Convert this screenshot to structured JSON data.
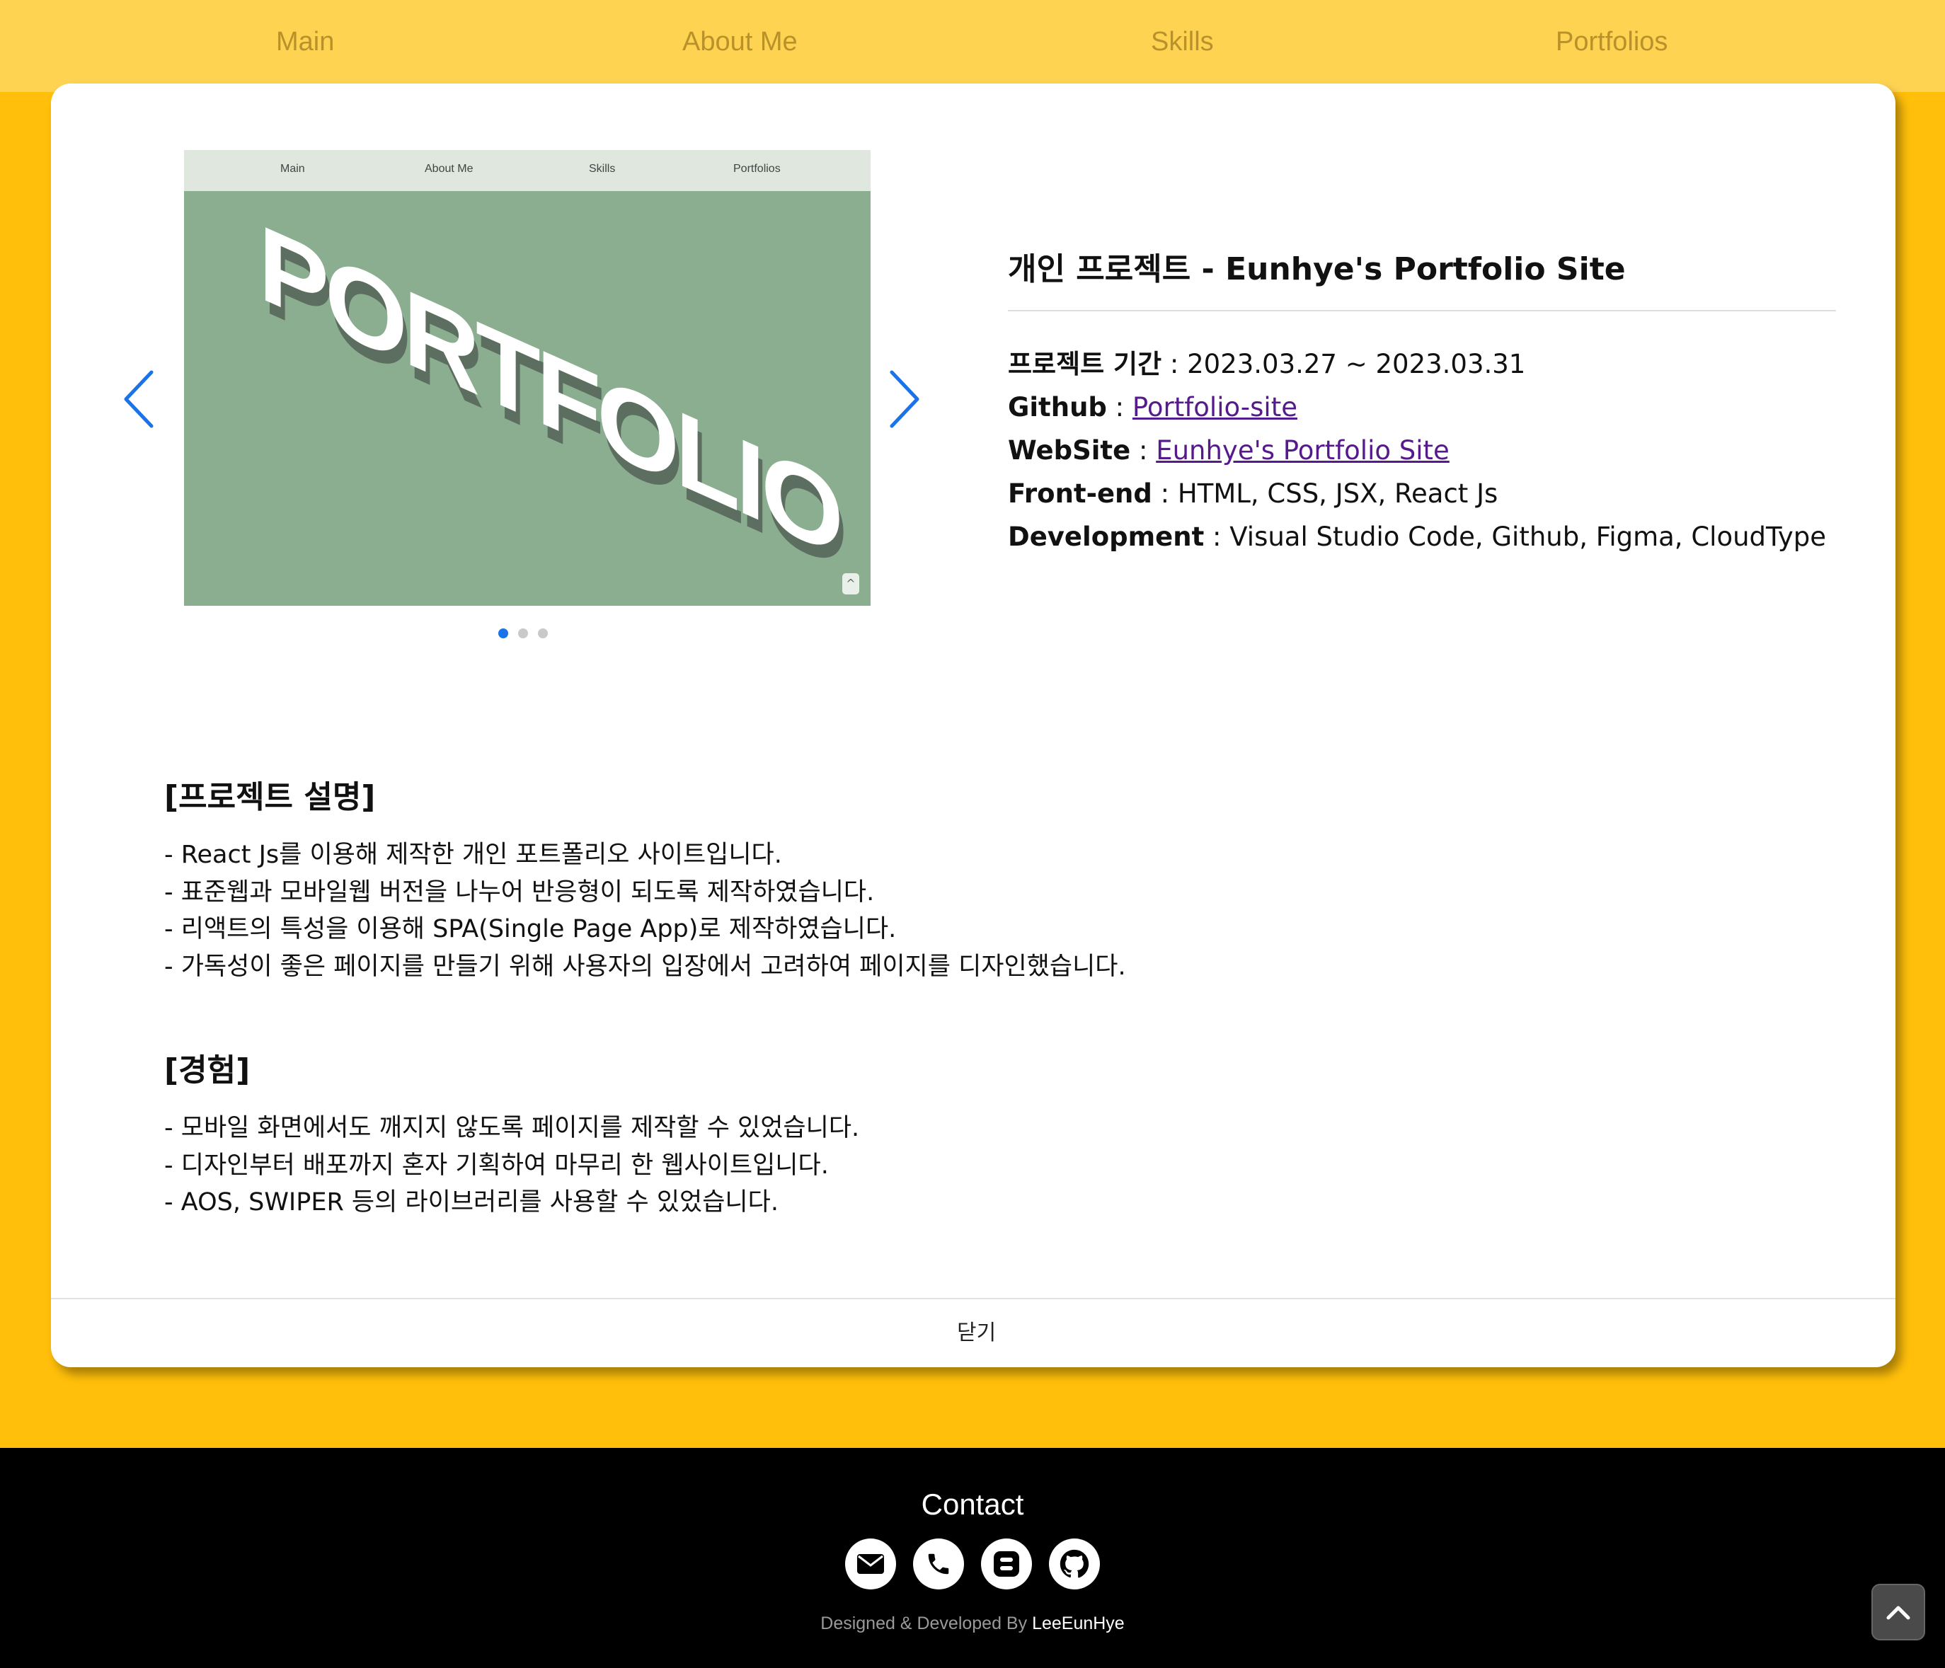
{
  "nav": {
    "items": [
      {
        "label": "Main"
      },
      {
        "label": "About Me"
      },
      {
        "label": "Skills"
      },
      {
        "label": "Portfolios"
      }
    ]
  },
  "slider": {
    "screenshot_nav": [
      "Main",
      "About Me",
      "Skills",
      "Portfolios"
    ],
    "hero_text": "PORTFOLIO",
    "slide_count": 3,
    "active_index": 0,
    "arrow_color": "#1a73e8",
    "hero_bg": "#8bae91"
  },
  "project": {
    "title": "개인 프로젝트 - Eunhye's Portfolio Site",
    "period_label": "프로젝트 기간",
    "period_value": "2023.03.27 ~ 2023.03.31",
    "github_label": "Github",
    "github_link": "Portfolio-site",
    "website_label": "WebSite",
    "website_link": "Eunhye's Portfolio Site",
    "frontend_label": "Front-end",
    "frontend_value": "HTML, CSS, JSX, React Js",
    "dev_label": "Development",
    "dev_value": "Visual Studio Code, Github, Figma, CloudType"
  },
  "description": {
    "heading": "[프로젝트 설명]",
    "lines": [
      "- React Js를 이용해 제작한 개인 포트폴리오 사이트입니다.",
      "- 표준웹과 모바일웹 버전을 나누어 반응형이 되도록 제작하였습니다.",
      "- 리액트의 특성을 이용해 SPA(Single Page App)로 제작하였습니다.",
      "- 가독성이 좋은 페이지를 만들기 위해 사용자의 입장에서 고려하여 페이지를 디자인했습니다."
    ]
  },
  "experience": {
    "heading": "[경험]",
    "lines": [
      "- 모바일 화면에서도 깨지지 않도록 페이지를 제작할 수 있었습니다.",
      "- 디자인부터 배포까지 혼자 기획하여 마무리 한 웹사이트입니다.",
      "- AOS, SWIPER 등의 라이브러리를 사용할 수 있었습니다."
    ]
  },
  "modal": {
    "close_label": "닫기"
  },
  "footer": {
    "contact_title": "Contact",
    "icons": [
      "email-icon",
      "phone-icon",
      "blog-icon",
      "github-icon"
    ],
    "credit_prefix": "Designed & Developed By ",
    "credit_author": "LeeEunHye"
  },
  "colors": {
    "page_bg": "#ffbf0a",
    "nav_bg": "#ffd352",
    "nav_text": "#b9912a",
    "footer_bg": "#000000"
  }
}
